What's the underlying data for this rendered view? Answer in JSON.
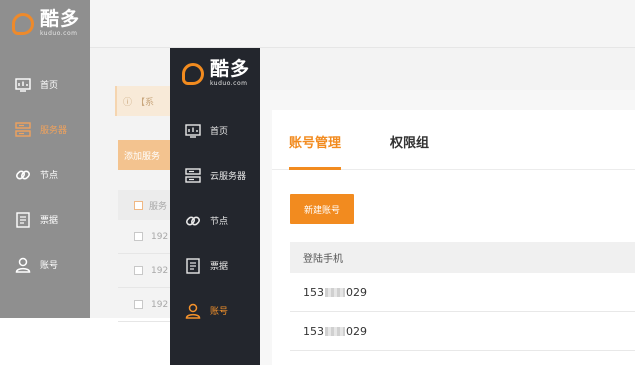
{
  "brand": {
    "name": "酷多",
    "domain": "kuduo.com",
    "accent": "#f28b1f"
  },
  "back_window": {
    "nav": [
      {
        "label": "首页",
        "icon": "dashboard-icon"
      },
      {
        "label": "服务器",
        "icon": "server-icon",
        "active": true
      },
      {
        "label": "节点",
        "icon": "link-icon"
      },
      {
        "label": "票据",
        "icon": "ticket-icon"
      },
      {
        "label": "账号",
        "icon": "user-icon"
      }
    ],
    "alert_text": "【系",
    "add_button": "添加服务",
    "table_header": "服务",
    "rows": [
      "192",
      "192",
      "192"
    ]
  },
  "front_window": {
    "nav": [
      {
        "label": "首页",
        "icon": "dashboard-icon"
      },
      {
        "label": "云服务器",
        "icon": "server-icon"
      },
      {
        "label": "节点",
        "icon": "link-icon"
      },
      {
        "label": "票据",
        "icon": "ticket-icon"
      },
      {
        "label": "账号",
        "icon": "user-icon",
        "active": true
      }
    ],
    "tabs": [
      {
        "label": "账号管理",
        "active": true
      },
      {
        "label": "权限组",
        "active": false
      }
    ],
    "new_button": "新建账号",
    "table": {
      "columns": [
        "登陆手机"
      ],
      "rows": [
        {
          "prefix": "153",
          "suffix": "029"
        },
        {
          "prefix": "153",
          "suffix": "029"
        }
      ]
    }
  }
}
